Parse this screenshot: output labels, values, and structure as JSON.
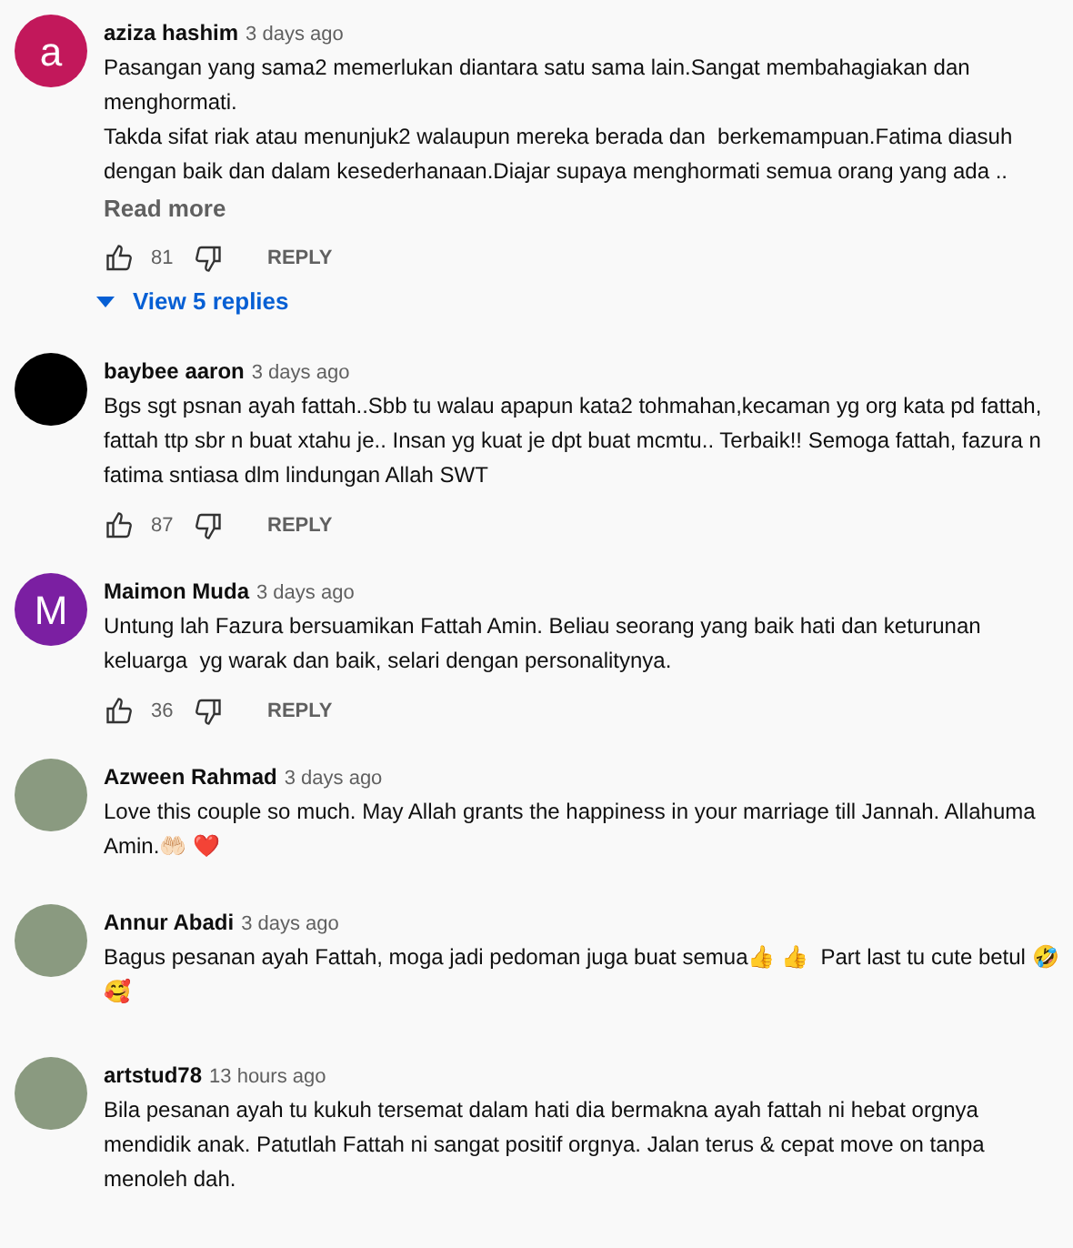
{
  "comments": [
    {
      "author": "aziza hashim",
      "time": "3 days ago",
      "avatar": {
        "kind": "letter",
        "letter": "a",
        "color": "#c2185b"
      },
      "paragraphs": [
        "Pasangan yang sama2 memerlukan diantara satu sama lain.Sangat membahagiakan dan menghormati.",
        "Takda sifat riak atau menunjuk2 walaupun mereka berada dan  berkemampuan.Fatima diasuh dengan baik dan dalam kesederhanaan.Diajar supaya menghormati semua orang yang ada .."
      ],
      "read_more": "Read more",
      "likes": "81",
      "reply": "REPLY",
      "view_replies": "View 5 replies"
    },
    {
      "author": "baybee aaron",
      "time": "3 days ago",
      "avatar": {
        "kind": "dark"
      },
      "paragraphs": [
        "Bgs sgt psnan ayah fattah..Sbb tu walau apapun kata2 tohmahan,kecaman yg org kata pd fattah, fattah ttp sbr n buat xtahu je.. Insan yg kuat je dpt buat mcmtu.. Terbaik!! Semoga fattah, fazura n fatima sntiasa dlm lindungan Allah SWT"
      ],
      "likes": "87",
      "reply": "REPLY"
    },
    {
      "author": "Maimon Muda",
      "time": "3 days ago",
      "avatar": {
        "kind": "letter",
        "letter": "M",
        "color": "#7b1fa2"
      },
      "paragraphs": [
        "Untung lah Fazura bersuamikan Fattah Amin. Beliau seorang yang baik hati dan keturunan keluarga  yg warak dan baik, selari dengan personalitynya."
      ],
      "likes": "36",
      "reply": "REPLY"
    },
    {
      "author": "Azween Rahmad",
      "time": "3 days ago",
      "avatar": {
        "kind": "photo"
      },
      "paragraphs": [
        "Love this couple so much. May Allah grants the happiness in your marriage till Jannah. Allahuma Amin.🤲🏻 ❤️"
      ]
    },
    {
      "author": "Annur Abadi",
      "time": "3 days ago",
      "avatar": {
        "kind": "photo"
      },
      "paragraphs": [
        "Bagus pesanan ayah Fattah, moga jadi pedoman juga buat semua👍 👍  Part last tu cute betul 🤣 🥰"
      ]
    },
    {
      "author": "artstud78",
      "time": "13 hours ago",
      "avatar": {
        "kind": "photo"
      },
      "paragraphs": [
        "Bila pesanan ayah tu kukuh tersemat dalam hati dia bermakna ayah fattah ni hebat orgnya mendidik anak. Patutlah Fattah ni sangat positif orgnya. Jalan terus & cepat move on tanpa menoleh dah."
      ]
    }
  ]
}
